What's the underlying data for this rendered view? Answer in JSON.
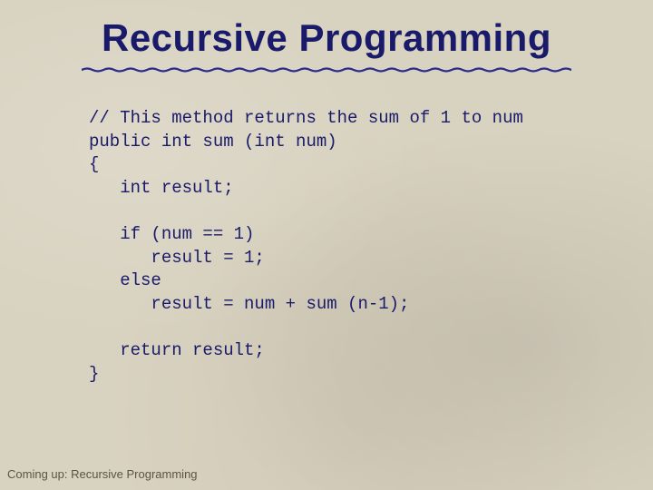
{
  "title": "Recursive Programming",
  "code": {
    "l1": "// This method returns the sum of 1 to num",
    "l2": "public int sum (int num)",
    "l3": "{",
    "l4": "   int result;",
    "l5": "",
    "l6": "   if (num == 1)",
    "l7": "      result = 1;",
    "l8": "   else",
    "l9": "      result = num + sum (n-1);",
    "l10": "",
    "l11": "   return result;",
    "l12": "}"
  },
  "footer": "Coming up: Recursive Programming"
}
